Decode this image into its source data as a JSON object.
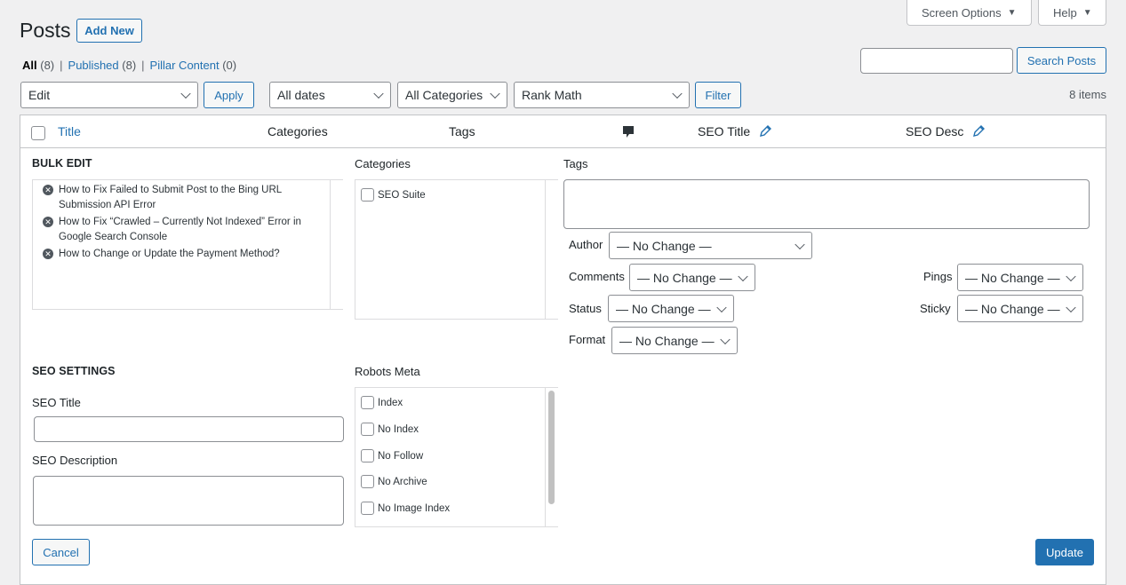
{
  "header": {
    "screen_options_label": "Screen Options",
    "help_label": "Help",
    "page_title": "Posts",
    "add_new_label": "Add New"
  },
  "views": {
    "all_label": "All",
    "all_count": "(8)",
    "published_label": "Published",
    "published_count": "(8)",
    "pillar_label": "Pillar Content",
    "pillar_count": "(0)",
    "separator": "|"
  },
  "search": {
    "placeholder": "",
    "button_label": "Search Posts"
  },
  "filters": {
    "bulk_action": "Edit",
    "apply_label": "Apply",
    "dates": "All dates",
    "categories": "All Categories",
    "seo_filter": "Rank Math",
    "filter_label": "Filter",
    "items_count": "8 items"
  },
  "table": {
    "col_title": "Title",
    "col_categories": "Categories",
    "col_tags": "Tags",
    "col_seo_title": "SEO Title",
    "col_seo_desc": "SEO Desc"
  },
  "bulk_edit": {
    "heading": "BULK EDIT",
    "posts": [
      "How to Fix Failed to Submit Post to the Bing URL Submission API Error",
      "How to Fix “Crawled – Currently Not Indexed” Error in Google Search Console",
      "How to Change or Update the Payment Method?"
    ],
    "categories_label": "Categories",
    "categories": [
      "SEO Suite"
    ],
    "tags_label": "Tags",
    "author_label": "Author",
    "author_value": "— No Change —",
    "comments_label": "Comments",
    "comments_value": "— No Change —",
    "pings_label": "Pings",
    "pings_value": "— No Change —",
    "status_label": "Status",
    "status_value": "— No Change —",
    "sticky_label": "Sticky",
    "sticky_value": "— No Change —",
    "format_label": "Format",
    "format_value": "— No Change —"
  },
  "seo_settings": {
    "heading": "SEO SETTINGS",
    "seo_title_label": "SEO Title",
    "seo_description_label": "SEO Description",
    "robots_label": "Robots Meta",
    "robots": [
      "Index",
      "No Index",
      "No Follow",
      "No Archive",
      "No Image Index"
    ]
  },
  "actions": {
    "cancel_label": "Cancel",
    "update_label": "Update"
  },
  "colors": {
    "accent": "#2271b1",
    "background": "#f0f0f1"
  }
}
